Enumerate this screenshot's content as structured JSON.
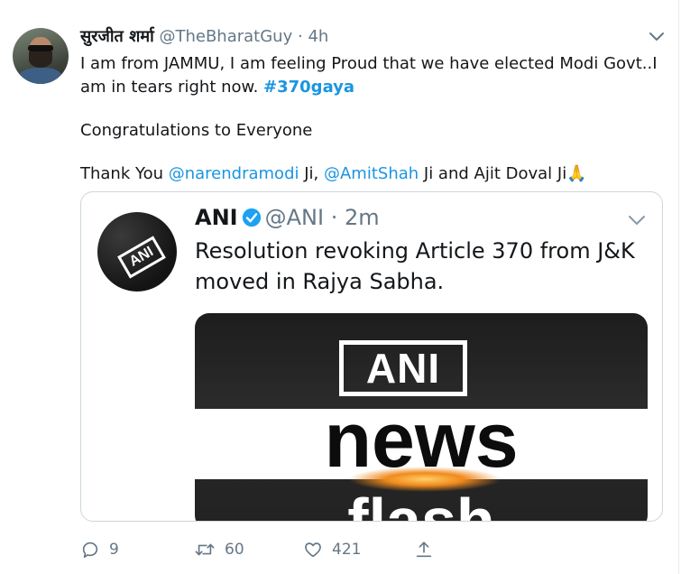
{
  "tweet": {
    "author_name": "सुरजीत शर्मा",
    "handle": "@TheBharatGuy",
    "separator": "·",
    "time": "4h",
    "line1_text": "I am from JAMMU, I am feeling Proud that we have elected Modi Govt..I am in tears right now. ",
    "hashtag": "#370gaya",
    "line2_text": "Congratulations to Everyone",
    "line3_prefix": "Thank You ",
    "mention1": "@narendramodi",
    "line3_mid1": " Ji, ",
    "mention2": "@AmitShah",
    "line3_mid2": " Ji and Ajit Doval Ji",
    "emoji": "🙏"
  },
  "quoted": {
    "author_name": "ANI",
    "handle": "@ANI",
    "separator": "·",
    "time": "2m",
    "text": "Resolution revoking Article 370 from J&K moved in Rajya Sabha.",
    "avatar_text": "ANI",
    "image": {
      "logo_text": "ANI",
      "headline": "news",
      "subline": "flash"
    }
  },
  "actions": {
    "reply_count": "9",
    "retweet_count": "60",
    "like_count": "421"
  },
  "icons": {
    "caret": "chevron-down-icon",
    "verified": "verified-badge-icon",
    "reply": "reply-icon",
    "retweet": "retweet-icon",
    "like": "heart-icon",
    "share": "share-icon"
  },
  "colors": {
    "link": "#1b95e0",
    "muted": "#657786",
    "text": "#14171a"
  }
}
